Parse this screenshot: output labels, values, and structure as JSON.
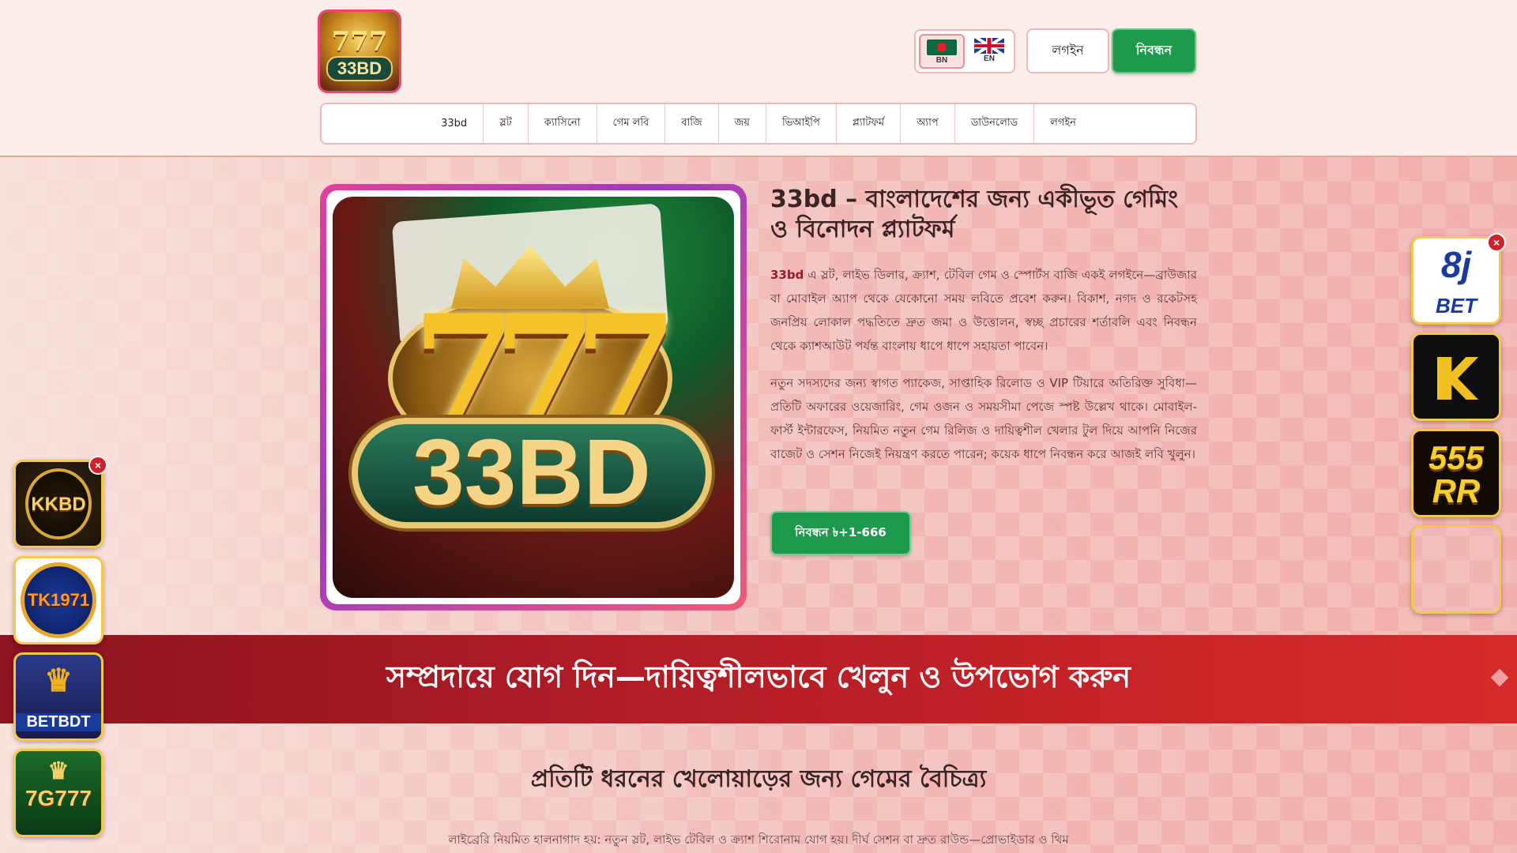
{
  "header": {
    "logo_text": "33BD",
    "logo_sevens": "777",
    "lang": [
      {
        "code": "BN"
      },
      {
        "code": "EN"
      }
    ],
    "login": "লগইন",
    "register": "নিবন্ধন"
  },
  "nav": [
    "33bd",
    "স্লট",
    "ক্যাসিনো",
    "গেম লবি",
    "বাজি",
    "জয়",
    "ভিআইপি",
    "প্ল্যাটফর্ম",
    "অ্যাপ",
    "ডাউনলোড",
    "লগইন"
  ],
  "hero": {
    "image_sevens": "777",
    "image_text": "33BD",
    "title": "33bd – বাংলাদেশের জন্য একীভূত গেমিং ও বিনোদন প্ল্যাটফর্ম",
    "p1_brand": "33bd",
    "p1_rest": " এ স্লট, লাইভ ডিলার, ক্র্যাশ, টেবিল গেম ও স্পোর্টস বাজি একই লগইনে—ব্রাউজার বা মোবাইল অ্যাপ থেকে যেকোনো সময় লবিতে প্রবেশ করুন। বিকাশ, নগদ ও রকেটসহ জনপ্রিয় লোকাল পদ্ধতিতে দ্রুত জমা ও উত্তোলন, স্বচ্ছ প্রচারের শর্তাবলি এবং নিবন্ধন থেকে ক্যাশআউট পর্যন্ত বাংলায় ধাপে ধাপে সহায়তা পাবেন।",
    "p2": "নতুন সদস্যদের জন্য স্বাগত প্যাকেজ, সাপ্তাহিক রিলোড ও VIP টিয়ারে অতিরিক্ত সুবিধা—প্রতিটি অফারের ওয়েজারিং, গেম ওজন ও সময়সীমা পেজে স্পষ্ট উল্লেখ থাকে। মোবাইল-ফার্স্ট ইন্টারফেস, নিয়মিত নতুন গেম রিলিজ ও দায়িত্বশীল খেলার টুল দিয়ে আপনি নিজের বাজেট ও সেশন নিজেই নিয়ন্ত্রণ করতে পারেন; কয়েক ধাপে নিবন্ধন করে আজই লবি খুলুন।",
    "cta": "নিবন্ধন ৳+1-666"
  },
  "banner": {
    "title": "সম্প্রদায়ে যোগ দিন—দায়িত্বশীলভাবে খেলুন ও উপভোগ করুন"
  },
  "section": {
    "title": "প্রতিটি ধরনের খেলোয়াড়ের জন্য গেমের বৈচিত্র্য",
    "text": "লাইব্রেরি নিয়মিত হালনাগাদ হয়: নতুন স্লট, লাইভ টেবিল ও ক্র্যাশ শিরোনাম যোগ হয়। দীর্ঘ সেশন বা দ্রুত রাউন্ড—প্রোভাইডার ও থিম"
  },
  "ads_left": [
    {
      "label": "KKBD"
    },
    {
      "label": "TK1971"
    },
    {
      "label": "BETBDT"
    },
    {
      "label": "7G777"
    }
  ],
  "ads_right": [
    {
      "label_top": "8j",
      "label_bottom": "BET"
    },
    {
      "label": ""
    },
    {
      "label_top": "555",
      "label_bottom": "RR"
    }
  ],
  "close_glyph": "×",
  "colors": {
    "primary_red": "#b01c26",
    "green": "#1e9a4e",
    "gold": "#f6c84a"
  }
}
